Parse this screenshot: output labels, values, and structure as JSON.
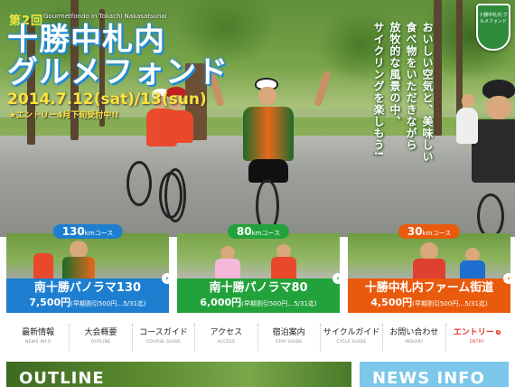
{
  "hero": {
    "edition": "第2回",
    "edition_en": "Gourmetfondo in Tokachi Nakasatsunai",
    "title_line1": "十勝中札内",
    "title_line2": "グルメフォンド",
    "date": "2014.7.12(sat)/13(sun)",
    "entry_note": "★エントリー4月下旬受付中!!",
    "catchcopy": [
      "おいしい空気と、美味しい",
      "食べ物をいただきながら",
      "放牧的な風景の中、",
      "サイクリングを楽しもう!"
    ],
    "emblem_text": "十勝中札内 グルメフォンド"
  },
  "courses": [
    {
      "distance": "130",
      "unit": "kmコース",
      "name": "南十勝パノラマ130",
      "price": "7,500円",
      "discount": "(早期割引500円…5/31迄)",
      "color": "#1e7fd0"
    },
    {
      "distance": "80",
      "unit": "kmコース",
      "name": "南十勝パノラマ80",
      "price": "6,000円",
      "discount": "(早期割引500円…5/31迄)",
      "color": "#22a23a"
    },
    {
      "distance": "30",
      "unit": "kmコース",
      "name": "十勝中札内ファーム街道",
      "price": "4,500円",
      "discount": "(早期割引500円…5/31迄)",
      "color": "#ea5a0c"
    }
  ],
  "nav": [
    {
      "jp": "最新情報",
      "en": "NEWS INFO"
    },
    {
      "jp": "大会概要",
      "en": "OUTLINE"
    },
    {
      "jp": "コースガイド",
      "en": "COURSE GUIDE"
    },
    {
      "jp": "アクセス",
      "en": "ACCESS"
    },
    {
      "jp": "宿泊案内",
      "en": "STAY GUIDE"
    },
    {
      "jp": "サイクルガイド",
      "en": "CYCLE GUIDE"
    },
    {
      "jp": "お問い合わせ",
      "en": "INQUIRY"
    },
    {
      "jp": "エントリー",
      "en": "ENTRY"
    }
  ],
  "sections": {
    "outline_title": "OUTLINE",
    "news_title": "NEWS INFO"
  }
}
